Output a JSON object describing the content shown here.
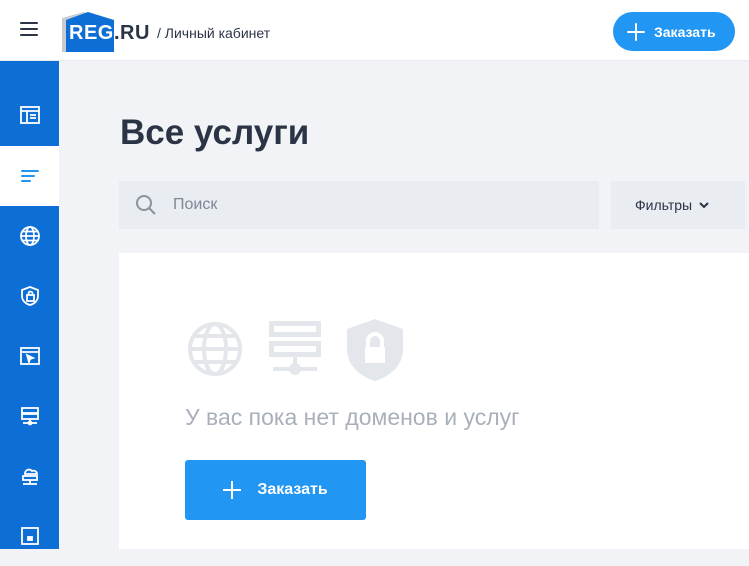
{
  "header": {
    "menu_icon": "hamburger-icon",
    "logo_reg": "REG",
    "logo_ru": ".RU",
    "breadcrumb": "/ Личный кабинет",
    "order_label": "Заказать"
  },
  "sidebar": {
    "items": [
      {
        "icon": "dashboard-icon",
        "active": false
      },
      {
        "icon": "list-icon",
        "active": true
      },
      {
        "icon": "globe-icon",
        "active": false
      },
      {
        "icon": "shield-lock-icon",
        "active": false
      },
      {
        "icon": "window-cursor-icon",
        "active": false
      },
      {
        "icon": "server-icon",
        "active": false
      },
      {
        "icon": "cloud-server-icon",
        "active": false
      },
      {
        "icon": "monitor-icon",
        "active": false
      }
    ]
  },
  "main": {
    "title": "Все услуги",
    "search_placeholder": "Поиск",
    "filters_label": "Фильтры",
    "empty_text": "У вас пока нет доменов и услуг",
    "order_label": "Заказать"
  },
  "colors": {
    "accent": "#2196f3",
    "sidebar": "#0d6ed6",
    "text": "#2b3445",
    "muted": "#a9b0bb"
  }
}
